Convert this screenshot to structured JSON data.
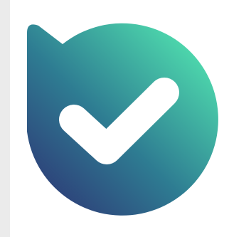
{
  "logo": {
    "name": "checkmark-badge-logo",
    "gradient_start": "#2d2f72",
    "gradient_mid": "#2e7c92",
    "gradient_end": "#52e5b0",
    "check_color": "#ffffff"
  },
  "background": {
    "page_color": "#ebebeb",
    "tile_color": "#ffffff"
  }
}
